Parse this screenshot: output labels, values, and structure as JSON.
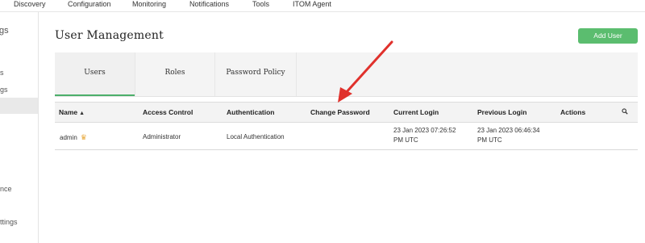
{
  "topnav": {
    "items": [
      "Discovery",
      "Configuration",
      "Monitoring",
      "Notifications",
      "Tools",
      "ITOM Agent"
    ]
  },
  "sidebar": {
    "items": [
      "gs",
      "s",
      "gs",
      "nce",
      "ttings"
    ]
  },
  "main": {
    "title": "User Management",
    "add_button": "Add User",
    "tabs": [
      {
        "label": "Users",
        "active": true
      },
      {
        "label": "Roles",
        "active": false
      },
      {
        "label": "Password Policy",
        "active": false
      }
    ]
  },
  "table": {
    "columns": [
      "Name",
      "Access Control",
      "Authentication",
      "Change Password",
      "Current Login",
      "Previous Login",
      "Actions"
    ],
    "rows": [
      {
        "name": "admin",
        "access_control": "Administrator",
        "authentication": "Local Authentication",
        "change_password": "",
        "current_login": [
          "23 Jan 2023 07:26:52",
          "PM UTC"
        ],
        "previous_login": [
          "23 Jan 2023 06:46:34",
          "PM UTC"
        ],
        "actions": ""
      }
    ]
  },
  "colors": {
    "accent_green": "#5bbd6f",
    "arrow_red": "#e0312c",
    "crown": "#e8a83a"
  },
  "icons": [
    "sort-ascending-icon",
    "crown-icon",
    "search-icon"
  ]
}
